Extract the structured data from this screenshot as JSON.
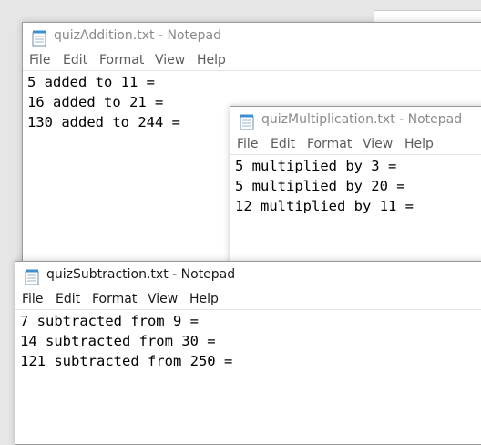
{
  "windows": {
    "addition": {
      "title": "quizAddition.txt - Notepad",
      "menu": [
        "File",
        "Edit",
        "Format",
        "View",
        "Help"
      ],
      "lines": [
        "5 added to 11 =",
        "16 added to 21 =",
        "130 added to 244 ="
      ]
    },
    "multiplication": {
      "title": "quizMultiplication.txt - Notepad",
      "menu": [
        "File",
        "Edit",
        "Format",
        "View",
        "Help"
      ],
      "lines": [
        "5 multiplied by 3 =",
        "5 multiplied by 20 =",
        "12 multiplied by 11 ="
      ]
    },
    "subtraction": {
      "title": "quizSubtraction.txt - Notepad",
      "menu": [
        "File",
        "Edit",
        "Format",
        "View",
        "Help"
      ],
      "lines": [
        "7 subtracted from 9 =",
        "14 subtracted from 30 =",
        "121 subtracted from 250 ="
      ]
    }
  },
  "colors": {
    "desktop": "#e6e6e6",
    "window_bg": "#ffffff",
    "title_active": "#1a1a1a",
    "title_inactive": "#8a8a8a",
    "icon_accent": "#3e8fd0"
  },
  "icons": {
    "app": "notepad-icon"
  }
}
